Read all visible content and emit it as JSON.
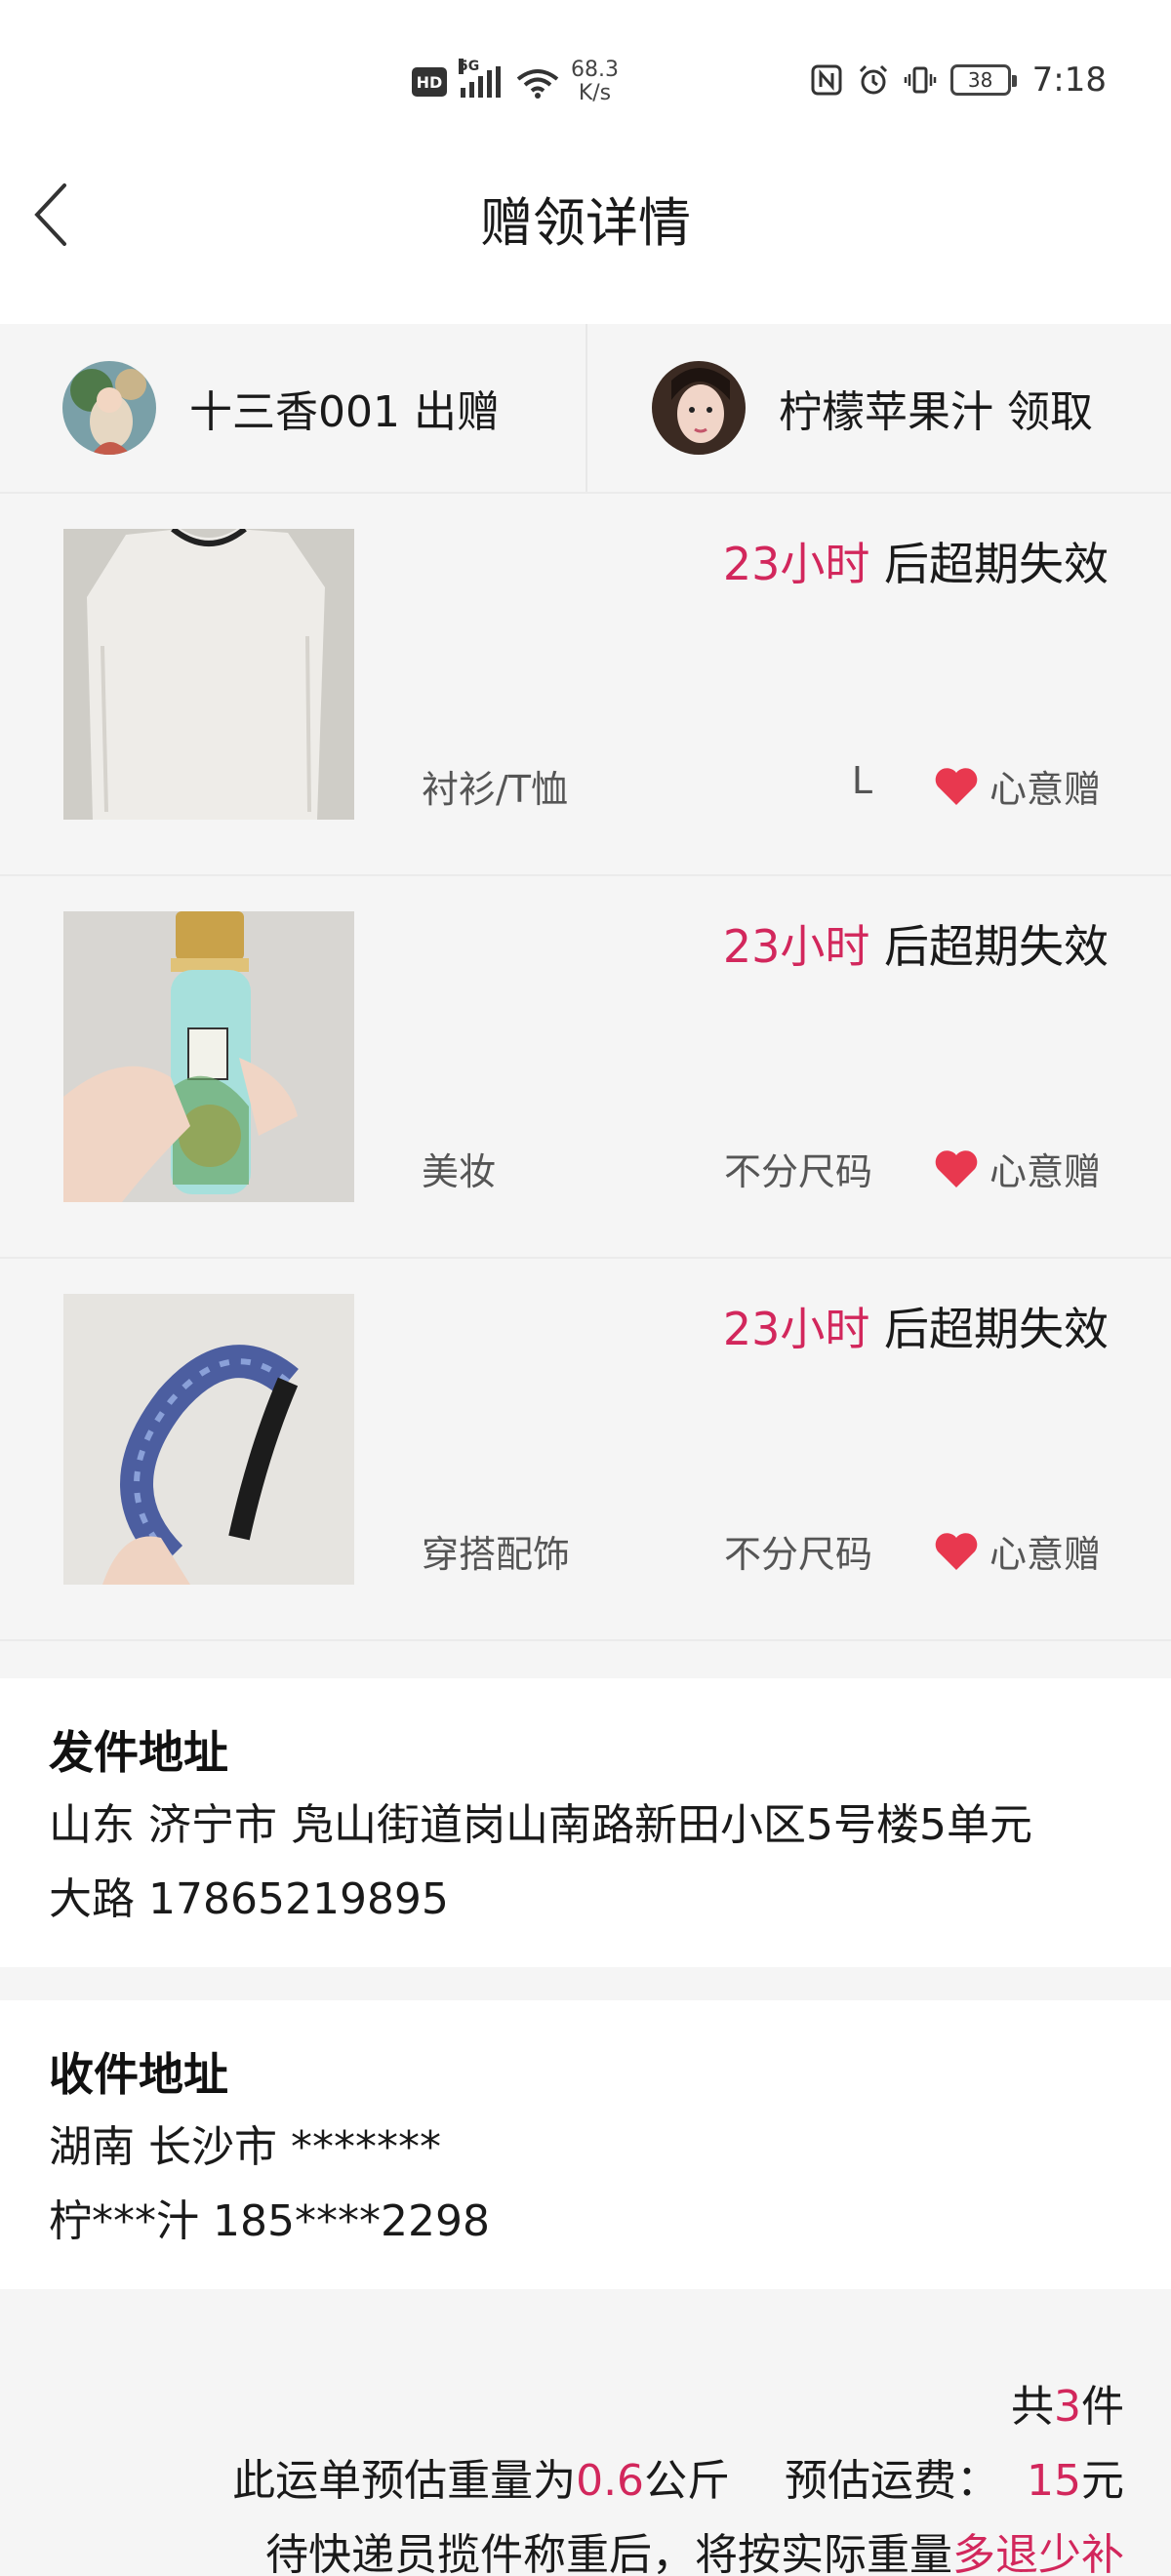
{
  "status_bar": {
    "network_badge": "HD",
    "signal_type": "5G",
    "speed_value": "68.3",
    "speed_unit": "K/s",
    "battery": "38",
    "time": "7:18"
  },
  "header": {
    "title": "赠领详情",
    "back_icon": "chevron-left-icon"
  },
  "users": {
    "giver": {
      "name": "十三香001",
      "action": "出赠"
    },
    "receiver": {
      "name": "柠檬苹果汁",
      "action": "领取"
    }
  },
  "items": [
    {
      "expiry_hours": "23小时",
      "expiry_suffix": " 后超期失效",
      "category": "衬衫/T恤",
      "size": "L",
      "gift_label": "心意赠"
    },
    {
      "expiry_hours": "23小时",
      "expiry_suffix": " 后超期失效",
      "category": "美妆",
      "size": "不分尺码",
      "gift_label": "心意赠"
    },
    {
      "expiry_hours": "23小时",
      "expiry_suffix": " 后超期失效",
      "category": "穿搭配饰",
      "size": "不分尺码",
      "gift_label": "心意赠"
    }
  ],
  "sender_address": {
    "heading": "发件地址",
    "line1": "山东 济宁市 凫山街道岗山南路新田小区5号楼5单元",
    "line2": "大路 17865219895"
  },
  "receiver_address": {
    "heading": "收件地址",
    "line1": "湖南 长沙市 *******",
    "line2": "柠***汁 185****2298"
  },
  "summary": {
    "count_prefix": "共",
    "count": "3",
    "count_suffix": "件",
    "weight_prefix": "此运单预估重量为",
    "weight": "0.6",
    "weight_unit": "公斤",
    "fee_label": "预估运费：",
    "fee": "15",
    "fee_unit": "元",
    "note_prefix": "待快递员揽件称重后，将按实际重量",
    "note_accent": "多退少补"
  },
  "colors": {
    "accent": "#d2275c",
    "heart": "#e8384f",
    "background": "#f5f5f5"
  }
}
